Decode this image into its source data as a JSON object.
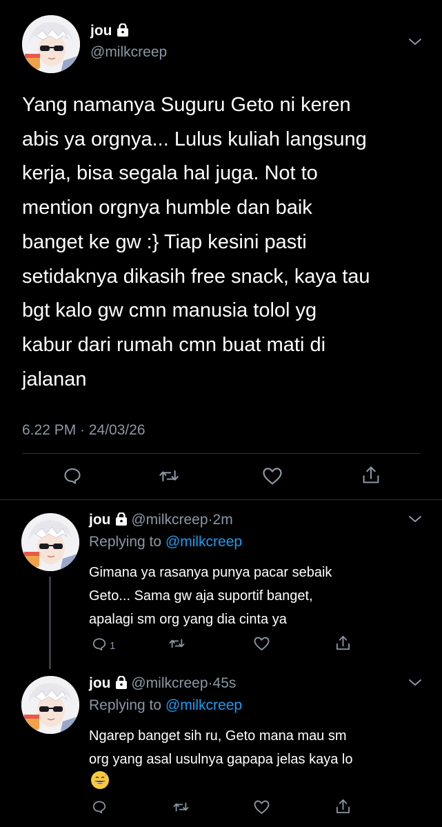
{
  "main_tweet": {
    "display_name": "jou",
    "handle": "@milkcreep",
    "text": "Yang namanya Suguru Geto ni keren\nabis ya orgnya... Lulus kuliah langsung\nkerja, bisa segala hal juga. Not to\nmention orgnya humble dan baik\nbanget ke gw :} Tiap kesini pasti\nsetidaknya dikasih free snack, kaya tau\nbgt kalo gw cmn manusia tolol yg\nkabur dari rumah cmn buat mati di\njalanan",
    "timestamp": "6.22 PM · 24/03/26"
  },
  "replies": [
    {
      "display_name": "jou",
      "handle": "@milkcreep",
      "separator": "·",
      "time": "2m",
      "replying_prefix": "Replying to ",
      "replying_to": "@milkcreep",
      "text": "Gimana ya rasanya punya pacar sebaik\nGeto... Sama gw aja suportif banget,\napalagi sm org yang dia cinta ya",
      "reply_count": "1"
    },
    {
      "display_name": "jou",
      "handle": "@milkcreep",
      "separator": "·",
      "time": "45s",
      "replying_prefix": "Replying to ",
      "replying_to": "@milkcreep",
      "text": "Ngarep banget sih ru, Geto mana mau sm\norg yang asal usulnya gapapa jelas kaya lo",
      "emoji": "grinning-sweat-emoji"
    }
  ],
  "icons": {
    "reply": "reply-icon",
    "retweet": "retweet-icon",
    "like": "like-icon",
    "share": "share-icon",
    "lock": "lock-icon",
    "chevron": "chevron-down-icon"
  },
  "colors": {
    "background": "#000000",
    "text": "#ffffff",
    "secondary": "#8b98a5",
    "link": "#1d9bf0",
    "divider": "#2f3336"
  }
}
